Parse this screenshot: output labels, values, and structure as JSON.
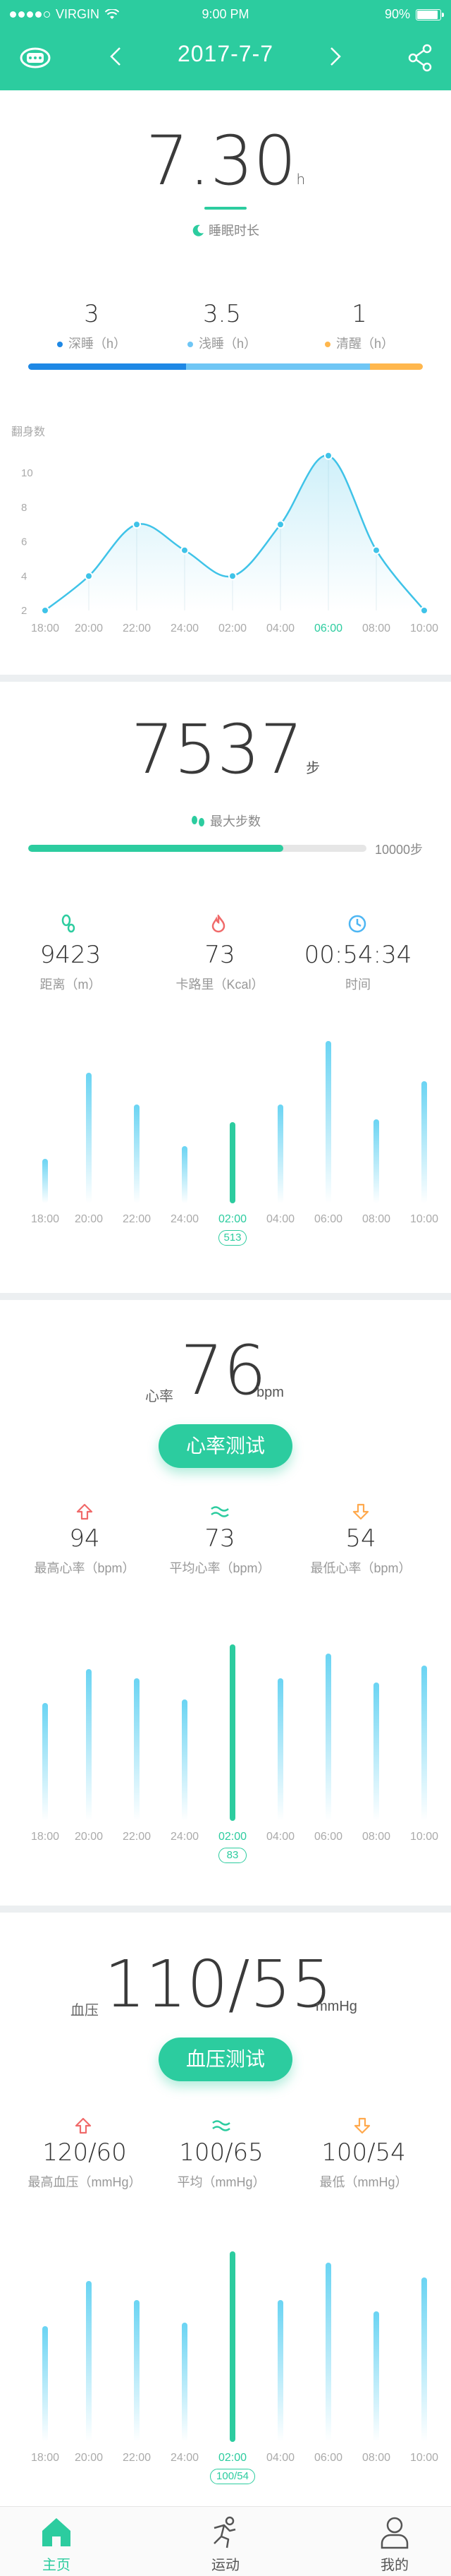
{
  "status_bar": {
    "carrier": "VIRGIN",
    "time": "9:00 PM",
    "battery": "90%"
  },
  "nav": {
    "date": "2017-7-7"
  },
  "sleep": {
    "value": "7.30",
    "unit": "h",
    "caption": "睡眠时长",
    "breakdown": [
      {
        "value": "3",
        "label": "深睡（h）",
        "color": "#1e88e5"
      },
      {
        "value": "3.5",
        "label": "浅睡（h）",
        "color": "#6fc6f5"
      },
      {
        "value": "1",
        "label": "清醒（h）",
        "color": "#ffb74d"
      }
    ],
    "chart_data": {
      "type": "line",
      "ylabel": "翻身数",
      "y_ticks": [
        "10",
        "8",
        "6",
        "4",
        "2"
      ],
      "ylim": [
        2,
        10
      ],
      "categories": [
        "18:00",
        "20:00",
        "22:00",
        "24:00",
        "02:00",
        "04:00",
        "06:00",
        "08:00",
        "10:00"
      ],
      "values": [
        2,
        4,
        7,
        5.5,
        4,
        7,
        11,
        5.5,
        2
      ],
      "highlight_category": "06:00",
      "color": "#3fc3e8"
    }
  },
  "steps": {
    "value": "7537",
    "unit": "步",
    "caption": "最大步数",
    "goal_label": "10000步",
    "progress": 0.7537,
    "metrics": [
      {
        "value": "9423",
        "label": "距离（m）",
        "icon": "footprint-icon",
        "color": "#2ccc9f"
      },
      {
        "value": "73",
        "label": "卡路里（Kcal）",
        "icon": "flame-icon",
        "color": "#f06a6a"
      },
      {
        "value": "00:54:34",
        "label": "时间",
        "icon": "clock-icon",
        "color": "#4db6f3"
      }
    ],
    "chart_data": {
      "type": "bar",
      "categories": [
        "18:00",
        "20:00",
        "22:00",
        "24:00",
        "02:00",
        "04:00",
        "06:00",
        "08:00",
        "10:00"
      ],
      "values": [
        280,
        825,
        625,
        360,
        513,
        625,
        1025,
        530,
        770
      ],
      "selected_category": "02:00",
      "selected_label": "513"
    }
  },
  "heart": {
    "label": "心率",
    "value": "76",
    "unit": "bpm",
    "button": "心率测试",
    "metrics": [
      {
        "value": "94",
        "label": "最高心率（bpm）",
        "icon": "arrow-up-icon",
        "color": "#f06a6a"
      },
      {
        "value": "73",
        "label": "平均心率（bpm）",
        "icon": "wave-icon",
        "color": "#2ccc9f"
      },
      {
        "value": "54",
        "label": "最低心率（bpm）",
        "icon": "arrow-down-icon",
        "color": "#ffa94d"
      }
    ],
    "chart_data": {
      "type": "bar",
      "categories": [
        "18:00",
        "20:00",
        "22:00",
        "24:00",
        "02:00",
        "04:00",
        "06:00",
        "08:00",
        "10:00"
      ],
      "values": [
        62,
        80,
        75,
        64,
        93,
        75,
        88,
        73,
        82
      ],
      "selected_category": "02:00",
      "selected_label": "83"
    }
  },
  "blood": {
    "label": "血压",
    "value": "110/55",
    "unit": "mmHg",
    "button": "血压测试",
    "metrics": [
      {
        "value": "120/60",
        "label": "最高血压（mmHg）",
        "icon": "arrow-up-icon",
        "color": "#f06a6a"
      },
      {
        "value": "100/65",
        "label": "平均（mmHg）",
        "icon": "wave-icon",
        "color": "#2ccc9f"
      },
      {
        "value": "100/54",
        "label": "最低（mmHg）",
        "icon": "arrow-down-icon",
        "color": "#ffa94d"
      }
    ],
    "chart_data": {
      "type": "bar",
      "categories": [
        "18:00",
        "20:00",
        "22:00",
        "24:00",
        "02:00",
        "04:00",
        "06:00",
        "08:00",
        "10:00"
      ],
      "values": [
        62,
        86,
        76,
        64,
        102,
        76,
        96,
        70,
        88
      ],
      "selected_category": "02:00",
      "selected_label": "100/54"
    }
  },
  "tabs": [
    {
      "label": "主页",
      "icon": "home-icon",
      "active": true
    },
    {
      "label": "运动",
      "icon": "running-icon",
      "active": false
    },
    {
      "label": "我的",
      "icon": "user-icon",
      "active": false
    }
  ]
}
